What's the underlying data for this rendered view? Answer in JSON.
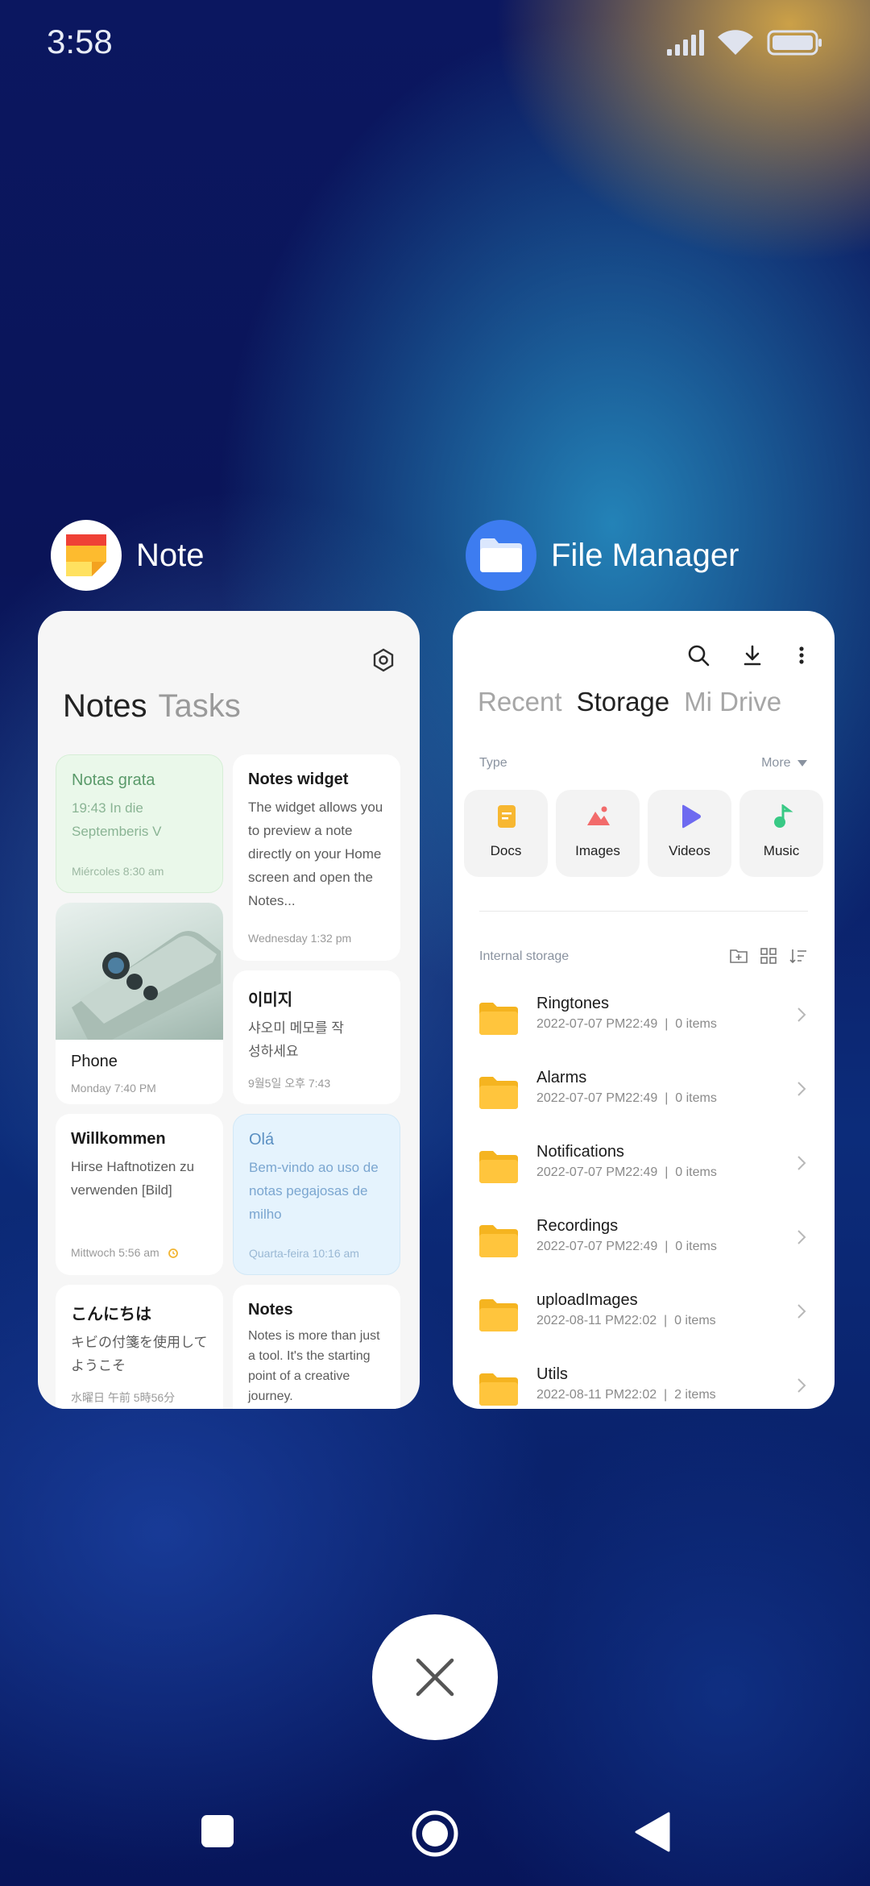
{
  "status": {
    "time": "3:58"
  },
  "apps": {
    "note": {
      "title": "Note",
      "tabs": {
        "active": "Notes",
        "inactive": "Tasks"
      },
      "notes": [
        {
          "title": "Notas grata",
          "body": "19:43 In die Septemberis V",
          "date": "Miércoles 8:30 am"
        },
        {
          "title": "Notes widget",
          "body": "The widget allows you to preview a note directly on your Home screen and open the Notes...",
          "date": "Wednesday 1:32 pm"
        },
        {
          "title": "Phone",
          "date": "Monday 7:40 PM"
        },
        {
          "title": "이미지",
          "body": "샤오미 메모를 작성하세요",
          "date": "9월5일 오후 7:43"
        },
        {
          "title": "Willkommen",
          "body": "Hirse Haftnotizen zu verwenden [Bild]",
          "date": "Mittwoch 5:56 am"
        },
        {
          "title": "Olá",
          "body": "Bem-vindo ao uso de notas pegajosas de milho",
          "date": "Quarta-feira 10:16 am"
        },
        {
          "title": "こんにちは",
          "body": "キビの付箋を使用してようこそ",
          "date": "水曜日 午前 5時56分"
        },
        {
          "title": "Notes",
          "body": "Notes is more than just a tool. It's the starting point of a creative journey."
        }
      ]
    },
    "file_manager": {
      "title": "File Manager",
      "tabs": [
        "Recent",
        "Storage",
        "Mi Drive"
      ],
      "active_tab": "Storage",
      "type_label": "Type",
      "more_label": "More",
      "types": [
        {
          "label": "Docs",
          "icon": "docs-icon",
          "color": "#f7b731"
        },
        {
          "label": "Images",
          "icon": "images-icon",
          "color": "#f26b6b"
        },
        {
          "label": "Videos",
          "icon": "videos-icon",
          "color": "#6e6af0"
        },
        {
          "label": "Music",
          "icon": "music-icon",
          "color": "#38c985"
        }
      ],
      "storage_label": "Internal storage",
      "folders": [
        {
          "name": "Ringtones",
          "date": "2022-07-07 PM22:49",
          "count": "0 items"
        },
        {
          "name": "Alarms",
          "date": "2022-07-07 PM22:49",
          "count": "0 items"
        },
        {
          "name": "Notifications",
          "date": "2022-07-07 PM22:49",
          "count": "0 items"
        },
        {
          "name": "Recordings",
          "date": "2022-07-07 PM22:49",
          "count": "0 items"
        },
        {
          "name": "uploadImages",
          "date": "2022-08-11 PM22:02",
          "count": "0 items"
        },
        {
          "name": "Utils",
          "date": "2022-08-11 PM22:02",
          "count": "2 items"
        }
      ]
    }
  },
  "colors": {
    "folder": "#ffc53d",
    "fm_icon_bg": "#3d7cf0"
  }
}
